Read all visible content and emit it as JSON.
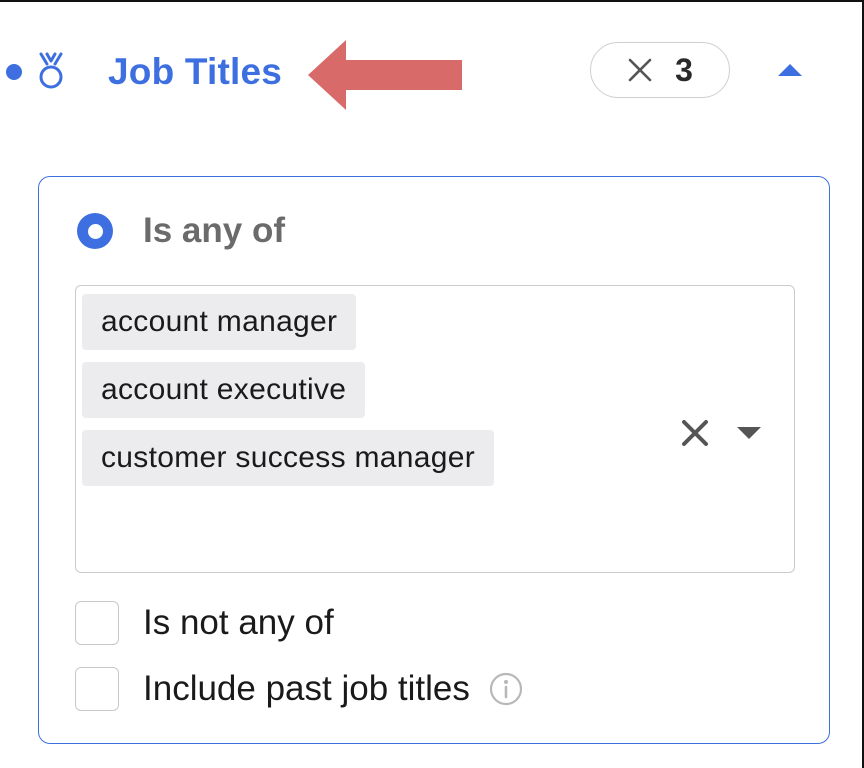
{
  "filter": {
    "title": "Job Titles",
    "icon": "medal-icon",
    "selected_count": "3",
    "accent_color": "#3d6fe0",
    "arrow_color": "#d86a6a"
  },
  "panel": {
    "mode_option": "Is any of",
    "selected_values": [
      "account manager",
      "account executive",
      "customer success manager"
    ],
    "exclude_option": "Is not any of",
    "past_titles_option": "Include past job titles"
  }
}
